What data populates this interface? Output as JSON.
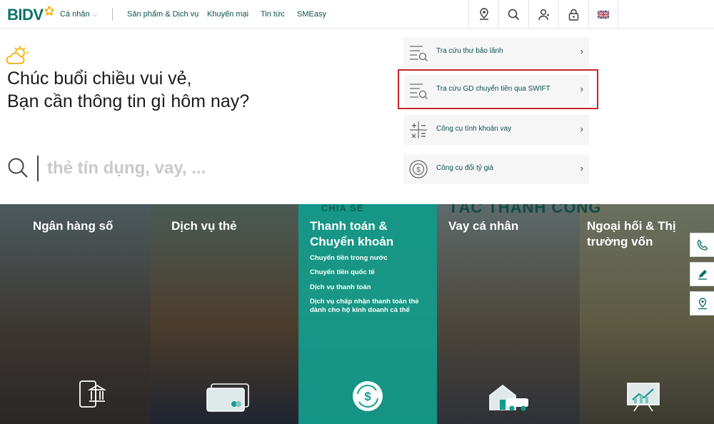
{
  "header": {
    "logo": "BIDV",
    "segment": "Cá nhân",
    "nav": [
      "Sản phẩm & Dịch vụ",
      "Khuyến mại",
      "Tin tức",
      "SMEasy"
    ],
    "icons": [
      "map-pin-icon",
      "search-icon",
      "user-icon",
      "lock-icon",
      "uk-flag-icon"
    ]
  },
  "greeting": {
    "line1": "Chúc buổi chiều vui vẻ,",
    "line2": "Bạn cần thông tin gì hôm nay?"
  },
  "search": {
    "placeholder": "thẻ tín dụng, vay, ..."
  },
  "quick_links": [
    {
      "label": "Tra cứu thư bảo lãnh",
      "icon": "document-search-icon"
    },
    {
      "label": "Tra cứu GD chuyển tiền qua SWIFT",
      "icon": "document-search-icon",
      "highlighted": true
    },
    {
      "label": "Công cụ tính khoản vay",
      "icon": "calculator-icon"
    },
    {
      "label": "Công cụ đổi tỷ giá",
      "icon": "currency-exchange-icon"
    }
  ],
  "banner": {
    "sign_text": "TÁC THÀNH CÔNG",
    "sign_text_left": "CHIA SẺ",
    "panels": [
      {
        "title": "Ngân hàng số",
        "icon": "mobile-bank-icon"
      },
      {
        "title": "Dịch vụ thẻ",
        "icon": "card-icon"
      },
      {
        "title": "Thanh toán & Chuyển khoản",
        "icon": "money-transfer-icon",
        "items": [
          "Chuyển tiền trong nước",
          "Chuyển tiền quốc tế",
          "Dịch vụ thanh toán",
          "Dịch vụ chấp nhận thanh toán thẻ dành cho hộ kinh doanh cá thể"
        ]
      },
      {
        "title": "Vay cá nhân",
        "icon": "house-car-icon"
      },
      {
        "title": "Ngoại hối & Thị trường vốn",
        "icon": "chart-board-icon"
      }
    ]
  },
  "side_buttons": [
    "phone-icon",
    "edit-icon",
    "location-icon"
  ],
  "colors": {
    "brand": "#0b7268",
    "accent": "#129c8c",
    "highlight": "#c4242b",
    "logo_star": "#f5b81c"
  }
}
